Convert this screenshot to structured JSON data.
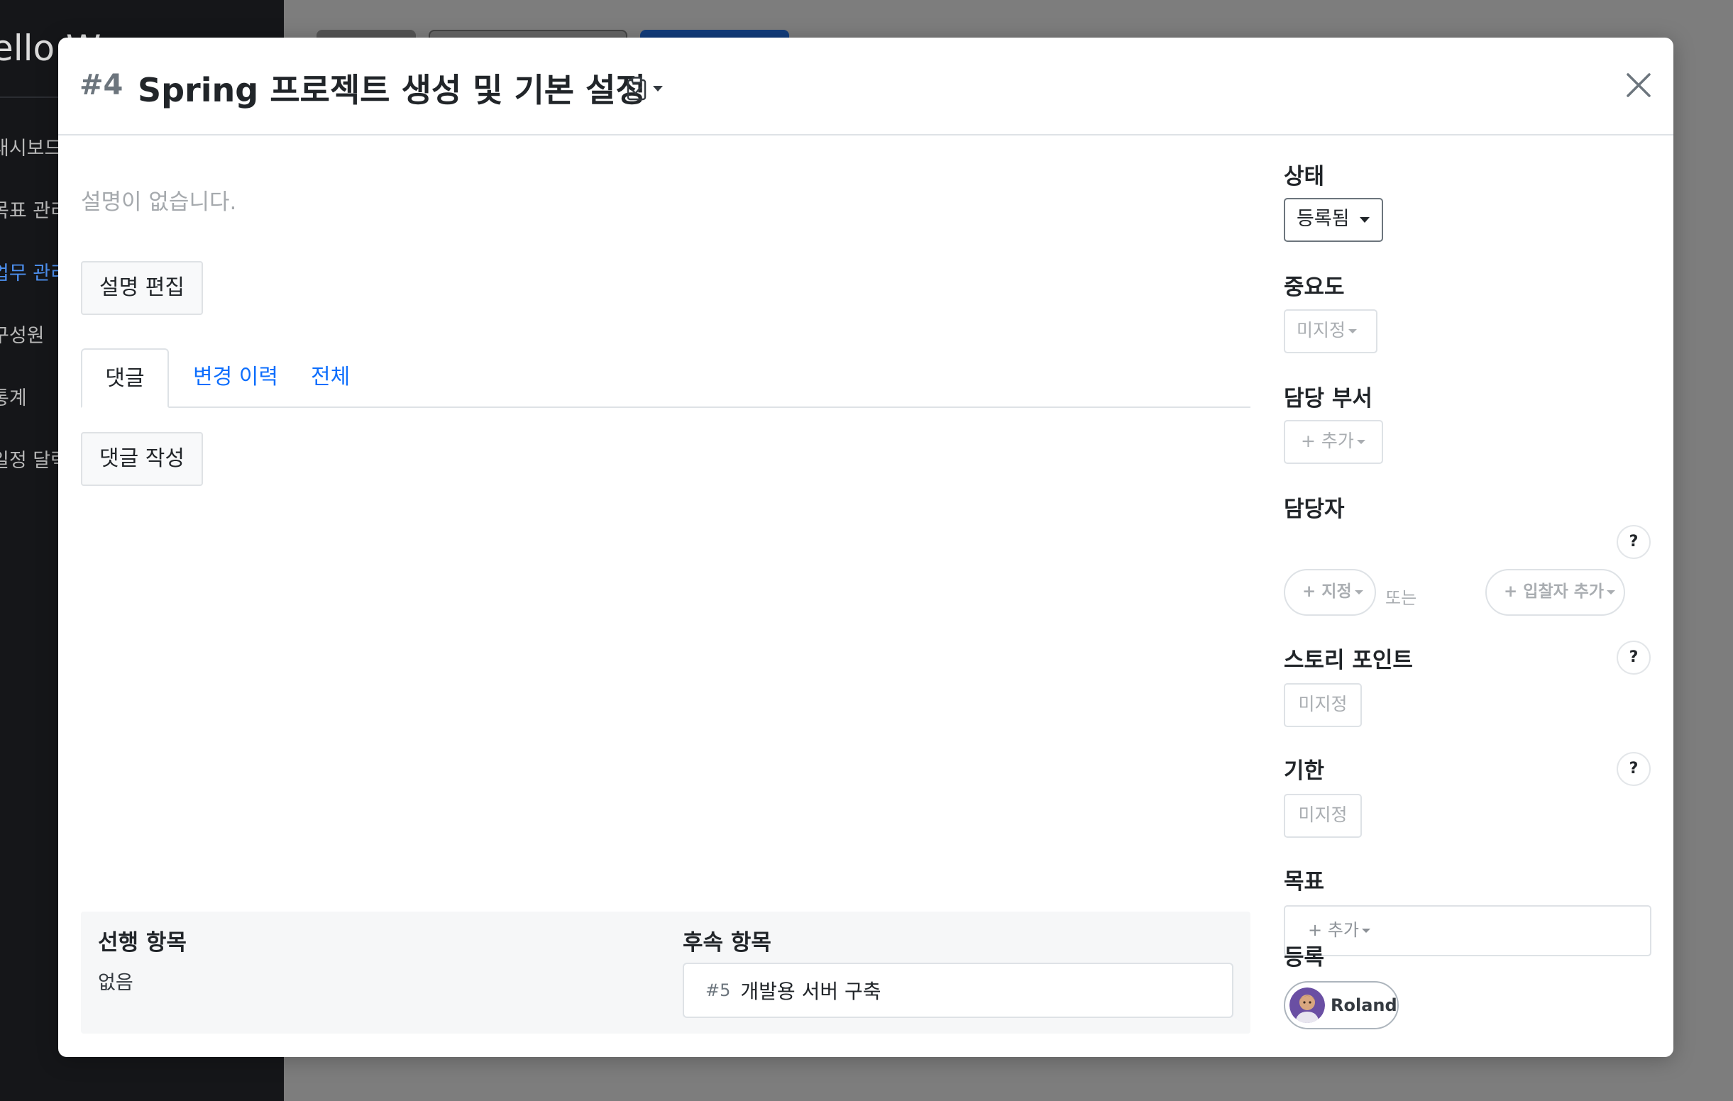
{
  "background": {
    "brand": "ello W",
    "nav": [
      {
        "label": "대시보드 화면"
      },
      {
        "label": "목표 관리"
      },
      {
        "label": "업무 관리"
      },
      {
        "label": "구성원"
      },
      {
        "label": "통계"
      },
      {
        "label": "일정 달력"
      }
    ]
  },
  "modal": {
    "issue_number": "#4",
    "issue_title": "Spring 프로젝트 생성 및 기본 설정",
    "description_empty": "설명이 없습니다.",
    "edit_description_button": "설명 편집",
    "tabs": [
      {
        "label": "댓글",
        "active": true
      },
      {
        "label": "변경 이력",
        "active": false
      },
      {
        "label": "전체",
        "active": false
      }
    ],
    "write_comment_button": "댓글 작성",
    "relations": {
      "predecessors_title": "선행 항목",
      "predecessors_empty": "없음",
      "successors_title": "후속 항목",
      "successors": [
        {
          "number": "#5",
          "title": "개발용 서버 구축"
        }
      ]
    }
  },
  "sidebar": {
    "status_label": "상태",
    "status_value": "등록됨",
    "priority_label": "중요도",
    "priority_value": "미지정",
    "department_label": "담당 부서",
    "department_add": "+ 추가",
    "assignee_label": "담당자",
    "assign_button": "+ 지정",
    "or_text": "또는",
    "participant_button": "+ 입찰자 추가",
    "story_points_label": "스토리 포인트",
    "story_points_value": "미지정",
    "due_label": "기한",
    "due_value": "미지정",
    "goal_label": "목표",
    "goal_add": "+  추가",
    "registered_label": "등록",
    "registered_by": "Roland",
    "help": "?"
  },
  "colors": {
    "accent": "#0d6efd",
    "muted": "#a9adb1",
    "overlay": "#7d7d7d",
    "sidebar_bg": "#151619"
  }
}
